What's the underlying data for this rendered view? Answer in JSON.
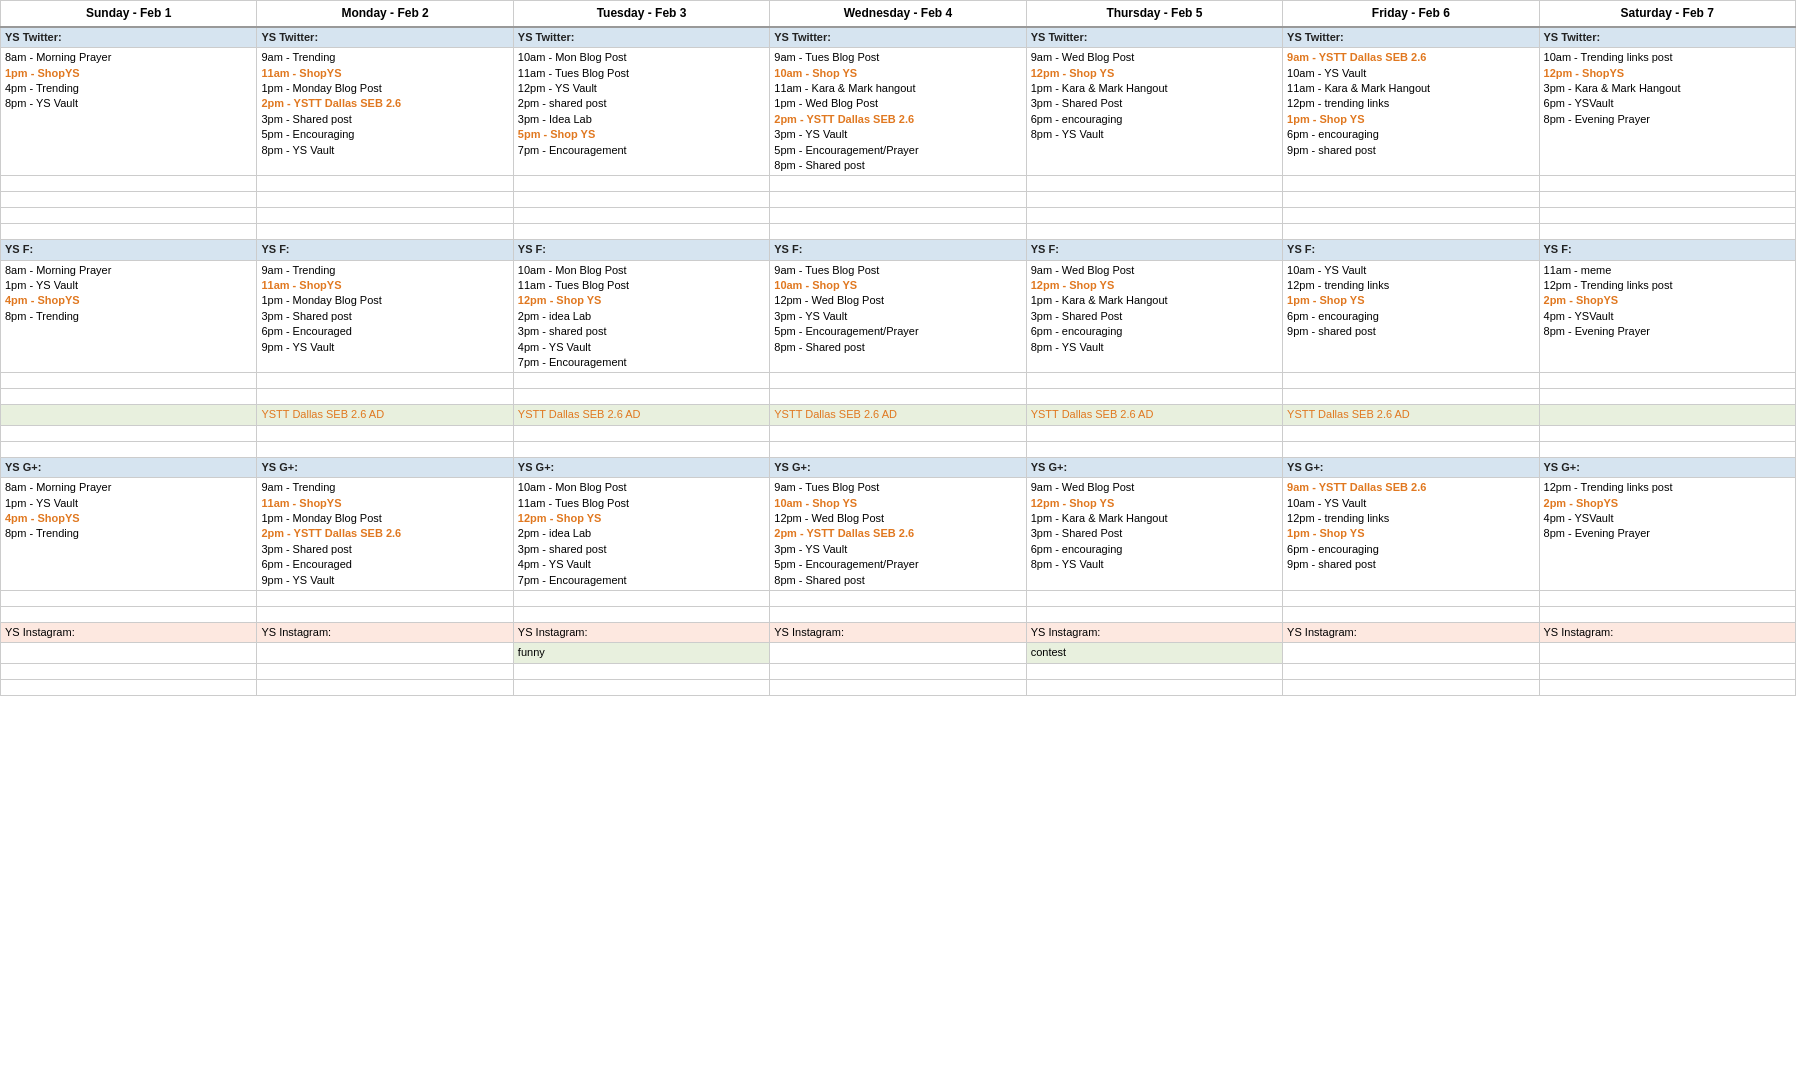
{
  "headers": [
    "Sunday - Feb 1",
    "Monday - Feb 2",
    "Tuesday - Feb 3",
    "Wednesday - Feb 4",
    "Thursday - Feb 5",
    "Friday - Feb 6",
    "Saturday - Feb 7"
  ],
  "sections": [
    {
      "id": "twitter",
      "label": "YS Twitter:",
      "rows": [
        {
          "cells": [
            [
              "8am - Morning Prayer",
              "1pm - ShopYS",
              "4pm - Trending",
              "8pm - YS Vault"
            ],
            [
              "9am - Trending",
              "11am - ShopYS",
              "1pm - Monday Blog Post",
              "2pm - YSTT Dallas SEB 2.6",
              "3pm - Shared post",
              "5pm - Encouraging",
              "8pm - YS Vault"
            ],
            [
              "10am - Mon Blog Post",
              "11am - Tues Blog Post",
              "12pm - YS Vault",
              "2pm - shared post",
              "3pm - Idea Lab",
              "5pm - Shop YS",
              "7pm - Encouragement"
            ],
            [
              "9am - Tues Blog Post",
              "10am - Shop YS",
              "11am - Kara & Mark hangout",
              "1pm - Wed Blog Post",
              "2pm - YSTT Dallas SEB 2.6",
              "3pm - YS Vault",
              "5pm - Encouragement/Prayer",
              "8pm - Shared post"
            ],
            [
              "9am - Wed Blog Post",
              "12pm - Shop YS",
              "1pm - Kara & Mark Hangout",
              "3pm - Shared Post",
              "6pm - encouraging",
              "8pm - YS Vault"
            ],
            [
              "9am - YSTT Dallas SEB 2.6",
              "10am - YS Vault",
              "11am - Kara & Mark Hangout",
              "12pm - trending links",
              "1pm - Shop YS",
              "6pm - encouraging",
              "9pm - shared post"
            ],
            [
              "10am - Trending links post",
              "12pm - ShopYS",
              "3pm - Kara & Mark Hangout",
              "6pm - YSVault",
              "8pm - Evening Prayer"
            ]
          ],
          "colors": [
            {
              "1": "orange",
              "2": null,
              "3": null,
              "4": null
            },
            {
              "1": null,
              "2": "orange",
              "3": null,
              "4": "orange",
              "5": null,
              "6": null,
              "7": null
            },
            {
              "1": null,
              "2": null,
              "3": null,
              "4": null,
              "5": null,
              "6": "orange",
              "7": null
            },
            {
              "1": null,
              "2": "orange",
              "3": null,
              "4": null,
              "5": "orange",
              "6": null,
              "7": null,
              "8": null
            },
            {
              "1": null,
              "2": "orange",
              "3": null,
              "4": null,
              "5": null,
              "6": null
            },
            {
              "1": "orange",
              "2": null,
              "3": null,
              "4": null,
              "5": "orange",
              "6": null,
              "7": null
            },
            {
              "1": null,
              "2": "orange",
              "3": null,
              "4": null,
              "5": null
            }
          ],
          "bgColors": [
            [
              null,
              null,
              null,
              null
            ],
            [
              null,
              "green",
              null,
              null,
              null,
              null,
              null
            ],
            [
              null,
              null,
              null,
              null,
              null,
              "green",
              null
            ],
            [
              null,
              "green",
              null,
              null,
              "green",
              null,
              null,
              null
            ],
            [
              null,
              "green",
              null,
              null,
              null,
              null
            ],
            [
              "green",
              null,
              null,
              null,
              "green",
              null,
              null
            ],
            [
              null,
              "green",
              null,
              null,
              null
            ]
          ]
        }
      ]
    },
    {
      "id": "ysf",
      "label": "YS F:",
      "rows": [
        {
          "cells": [
            [
              "8am - Morning Prayer",
              "1pm - YS Vault",
              "4pm - ShopYS",
              "8pm - Trending"
            ],
            [
              "9am - Trending",
              "11am - ShopYS",
              "1pm - Monday Blog Post",
              "3pm - Shared post",
              "6pm - Encouraged",
              "9pm - YS Vault"
            ],
            [
              "10am - Mon Blog Post",
              "11am - Tues Blog Post",
              "12pm - Shop YS",
              "2pm - idea Lab",
              "3pm - shared post",
              "4pm - YS Vault",
              "7pm - Encouragement"
            ],
            [
              "9am - Tues Blog Post",
              "10am - Shop YS",
              "12pm - Wed Blog Post",
              "3pm - YS Vault",
              "5pm - Encouragement/Prayer",
              "8pm - Shared post"
            ],
            [
              "9am - Wed Blog Post",
              "12pm - Shop YS",
              "1pm - Kara & Mark Hangout",
              "3pm - Shared Post",
              "6pm - encouraging",
              "8pm - YS Vault"
            ],
            [
              "10am - YS Vault",
              "12pm - trending links",
              "1pm - Shop YS",
              "6pm - encouraging",
              "9pm - shared post"
            ],
            [
              "11am - meme",
              "12pm - Trending links post",
              "2pm - ShopYS",
              "4pm - YSVault",
              "8pm - Evening Prayer"
            ]
          ]
        }
      ]
    },
    {
      "id": "ad",
      "label": "YSTT Dallas SEB 2.6 AD",
      "cells": [
        "",
        "YSTT Dallas SEB 2.6 AD",
        "YSTT Dallas SEB 2.6 AD",
        "YSTT Dallas SEB 2.6 AD",
        "YSTT Dallas SEB 2.6 AD",
        "YSTT Dallas SEB 2.6 AD",
        ""
      ]
    },
    {
      "id": "ysgplus",
      "label": "YS G+:",
      "rows": [
        {
          "cells": [
            [
              "8am - Morning Prayer",
              "1pm - YS Vault",
              "4pm - ShopYS",
              "8pm - Trending"
            ],
            [
              "9am - Trending",
              "11am - ShopYS",
              "1pm - Monday Blog Post",
              "2pm - YSTT Dallas SEB 2.6",
              "3pm - Shared post",
              "6pm - Encouraged",
              "9pm - YS Vault"
            ],
            [
              "10am - Mon Blog Post",
              "11am - Tues Blog Post",
              "12pm - Shop YS",
              "2pm - idea Lab",
              "3pm - shared post",
              "4pm - YS Vault",
              "7pm - Encouragement"
            ],
            [
              "9am - Tues Blog Post",
              "10am - Shop YS",
              "12pm - Wed Blog Post",
              "2pm - YSTT Dallas SEB 2.6",
              "3pm - YS Vault",
              "5pm - Encouragement/Prayer",
              "8pm - Shared post"
            ],
            [
              "9am - Wed Blog Post",
              "12pm - Shop YS",
              "1pm - Kara & Mark Hangout",
              "3pm - Shared Post",
              "6pm - encouraging",
              "8pm - YS Vault"
            ],
            [
              "9am - YSTT Dallas SEB 2.6",
              "10am - YS Vault",
              "12pm - trending links",
              "1pm - Shop YS",
              "6pm - encouraging",
              "9pm - shared post"
            ],
            [
              "12pm - Trending links post",
              "2pm - ShopYS",
              "4pm - YSVault",
              "8pm - Evening Prayer"
            ]
          ]
        }
      ]
    },
    {
      "id": "instagram",
      "label": "YS Instagram:",
      "rows": [
        {
          "cells": [
            [],
            [],
            [
              "funny"
            ],
            [],
            [
              "contest"
            ],
            [],
            []
          ]
        }
      ]
    }
  ]
}
